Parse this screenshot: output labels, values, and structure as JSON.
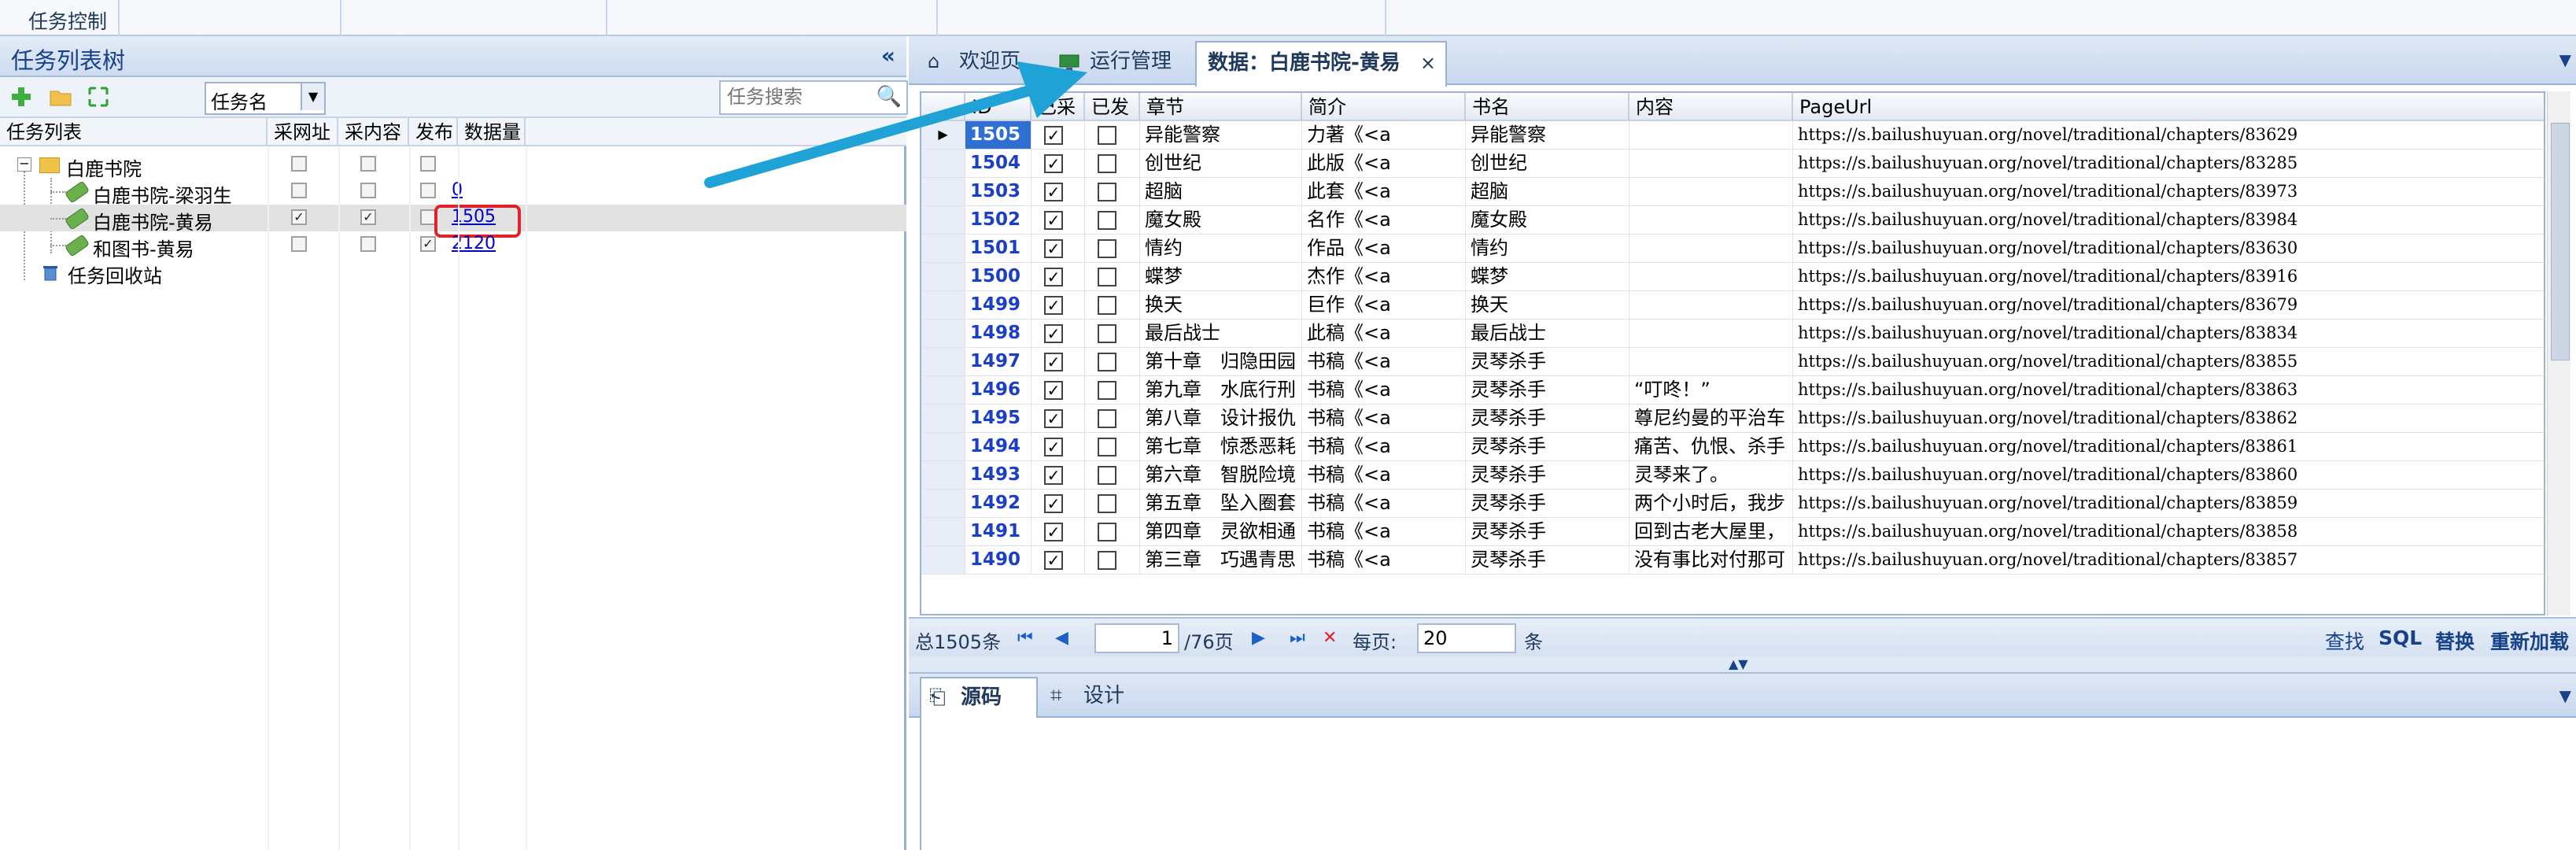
{
  "ribbon": {
    "label": "任务控制"
  },
  "left": {
    "title": "任务列表树",
    "filter_value": "任务名",
    "search_placeholder": "任务搜索",
    "columns": [
      "任务列表",
      "采网址",
      "采内容",
      "发布",
      "数据量"
    ],
    "tree": {
      "root": "白鹿书院",
      "children": [
        {
          "label": "白鹿书院-梁羽生",
          "url": false,
          "content": false,
          "publish": false,
          "count": "0"
        },
        {
          "label": "白鹿书院-黄易",
          "url": true,
          "content": true,
          "publish": false,
          "count": "1505"
        },
        {
          "label": "和图书-黄易",
          "url": false,
          "content": false,
          "publish": true,
          "count": "2120"
        }
      ],
      "recycle": "任务回收站"
    }
  },
  "tabs": [
    {
      "label": "欢迎页",
      "icon": "home-icon"
    },
    {
      "label": "运行管理",
      "icon": "monitor-icon"
    },
    {
      "label": "数据：白鹿书院-黄易",
      "icon": ""
    }
  ],
  "grid": {
    "columns": [
      "ID",
      "已采",
      "已发",
      "章节",
      "简介",
      "书名",
      "内容",
      "PageUrl"
    ],
    "rows": [
      {
        "id": "1505",
        "caught": true,
        "sent": false,
        "chapter": "异能警察",
        "intro": "力著《<a",
        "book": "异能警察",
        "content": "",
        "url": "https://s.bailushuyuan.org/novel/traditional/chapters/83629"
      },
      {
        "id": "1504",
        "caught": true,
        "sent": false,
        "chapter": "创世纪",
        "intro": "此版《<a",
        "book": "创世纪",
        "content": "",
        "url": "https://s.bailushuyuan.org/novel/traditional/chapters/83285"
      },
      {
        "id": "1503",
        "caught": true,
        "sent": false,
        "chapter": "超脑",
        "intro": "此套《<a",
        "book": "超脑",
        "content": "",
        "url": "https://s.bailushuyuan.org/novel/traditional/chapters/83973"
      },
      {
        "id": "1502",
        "caught": true,
        "sent": false,
        "chapter": "魔女殿",
        "intro": "名作《<a",
        "book": "魔女殿",
        "content": "",
        "url": "https://s.bailushuyuan.org/novel/traditional/chapters/83984"
      },
      {
        "id": "1501",
        "caught": true,
        "sent": false,
        "chapter": "情约",
        "intro": "作品《<a",
        "book": "情约",
        "content": "",
        "url": "https://s.bailushuyuan.org/novel/traditional/chapters/83630"
      },
      {
        "id": "1500",
        "caught": true,
        "sent": false,
        "chapter": "蝶梦",
        "intro": "杰作《<a",
        "book": "蝶梦",
        "content": "",
        "url": "https://s.bailushuyuan.org/novel/traditional/chapters/83916"
      },
      {
        "id": "1499",
        "caught": true,
        "sent": false,
        "chapter": "换天",
        "intro": "巨作《<a",
        "book": "换天",
        "content": "",
        "url": "https://s.bailushuyuan.org/novel/traditional/chapters/83679"
      },
      {
        "id": "1498",
        "caught": true,
        "sent": false,
        "chapter": "最后战士",
        "intro": "此稿《<a",
        "book": "最后战士",
        "content": "",
        "url": "https://s.bailushuyuan.org/novel/traditional/chapters/83834"
      },
      {
        "id": "1497",
        "caught": true,
        "sent": false,
        "chapter": "第十章　归隐田园",
        "intro": "书稿《<a",
        "book": "灵琴杀手",
        "content": "",
        "url": "https://s.bailushuyuan.org/novel/traditional/chapters/83855"
      },
      {
        "id": "1496",
        "caught": true,
        "sent": false,
        "chapter": "第九章　水底行刑",
        "intro": "书稿《<a",
        "book": "灵琴杀手",
        "content": "“叮咚！”",
        "url": "https://s.bailushuyuan.org/novel/traditional/chapters/83863"
      },
      {
        "id": "1495",
        "caught": true,
        "sent": false,
        "chapter": "第八章　设计报仇",
        "intro": "书稿《<a",
        "book": "灵琴杀手",
        "content": "尊尼约曼的平治车",
        "url": "https://s.bailushuyuan.org/novel/traditional/chapters/83862"
      },
      {
        "id": "1494",
        "caught": true,
        "sent": false,
        "chapter": "第七章　惊悉恶耗",
        "intro": "书稿《<a",
        "book": "灵琴杀手",
        "content": "痛苦、仇恨、杀手",
        "url": "https://s.bailushuyuan.org/novel/traditional/chapters/83861"
      },
      {
        "id": "1493",
        "caught": true,
        "sent": false,
        "chapter": "第六章　智脱险境",
        "intro": "书稿《<a",
        "book": "灵琴杀手",
        "content": "灵琴来了。",
        "url": "https://s.bailushuyuan.org/novel/traditional/chapters/83860"
      },
      {
        "id": "1492",
        "caught": true,
        "sent": false,
        "chapter": "第五章　坠入圈套",
        "intro": "书稿《<a",
        "book": "灵琴杀手",
        "content": "两个小时后，我步",
        "url": "https://s.bailushuyuan.org/novel/traditional/chapters/83859"
      },
      {
        "id": "1491",
        "caught": true,
        "sent": false,
        "chapter": "第四章　灵欲相通",
        "intro": "书稿《<a",
        "book": "灵琴杀手",
        "content": "回到古老大屋里，",
        "url": "https://s.bailushuyuan.org/novel/traditional/chapters/83858"
      },
      {
        "id": "1490",
        "caught": true,
        "sent": false,
        "chapter": "第三章　巧遇青思",
        "intro": "书稿《<a",
        "book": "灵琴杀手",
        "content": "没有事比对付那可",
        "url": "https://s.bailushuyuan.org/novel/traditional/chapters/83857"
      }
    ]
  },
  "pager": {
    "total": "总1505条",
    "page": "1",
    "pages": "/76页",
    "per_page_label": "每页:",
    "per_page": "20",
    "unit": "条",
    "actions": [
      "查找",
      "SQL",
      "替换",
      "重新加载"
    ]
  },
  "bottom_tabs": [
    {
      "label": "源码",
      "icon": "source-icon"
    },
    {
      "label": "设计",
      "icon": "crop-icon"
    }
  ],
  "colors": {
    "accent": "#15428b",
    "highlight": "#e0232b",
    "arrow": "#1fa3d6",
    "id_text": "#1b3fc4"
  }
}
